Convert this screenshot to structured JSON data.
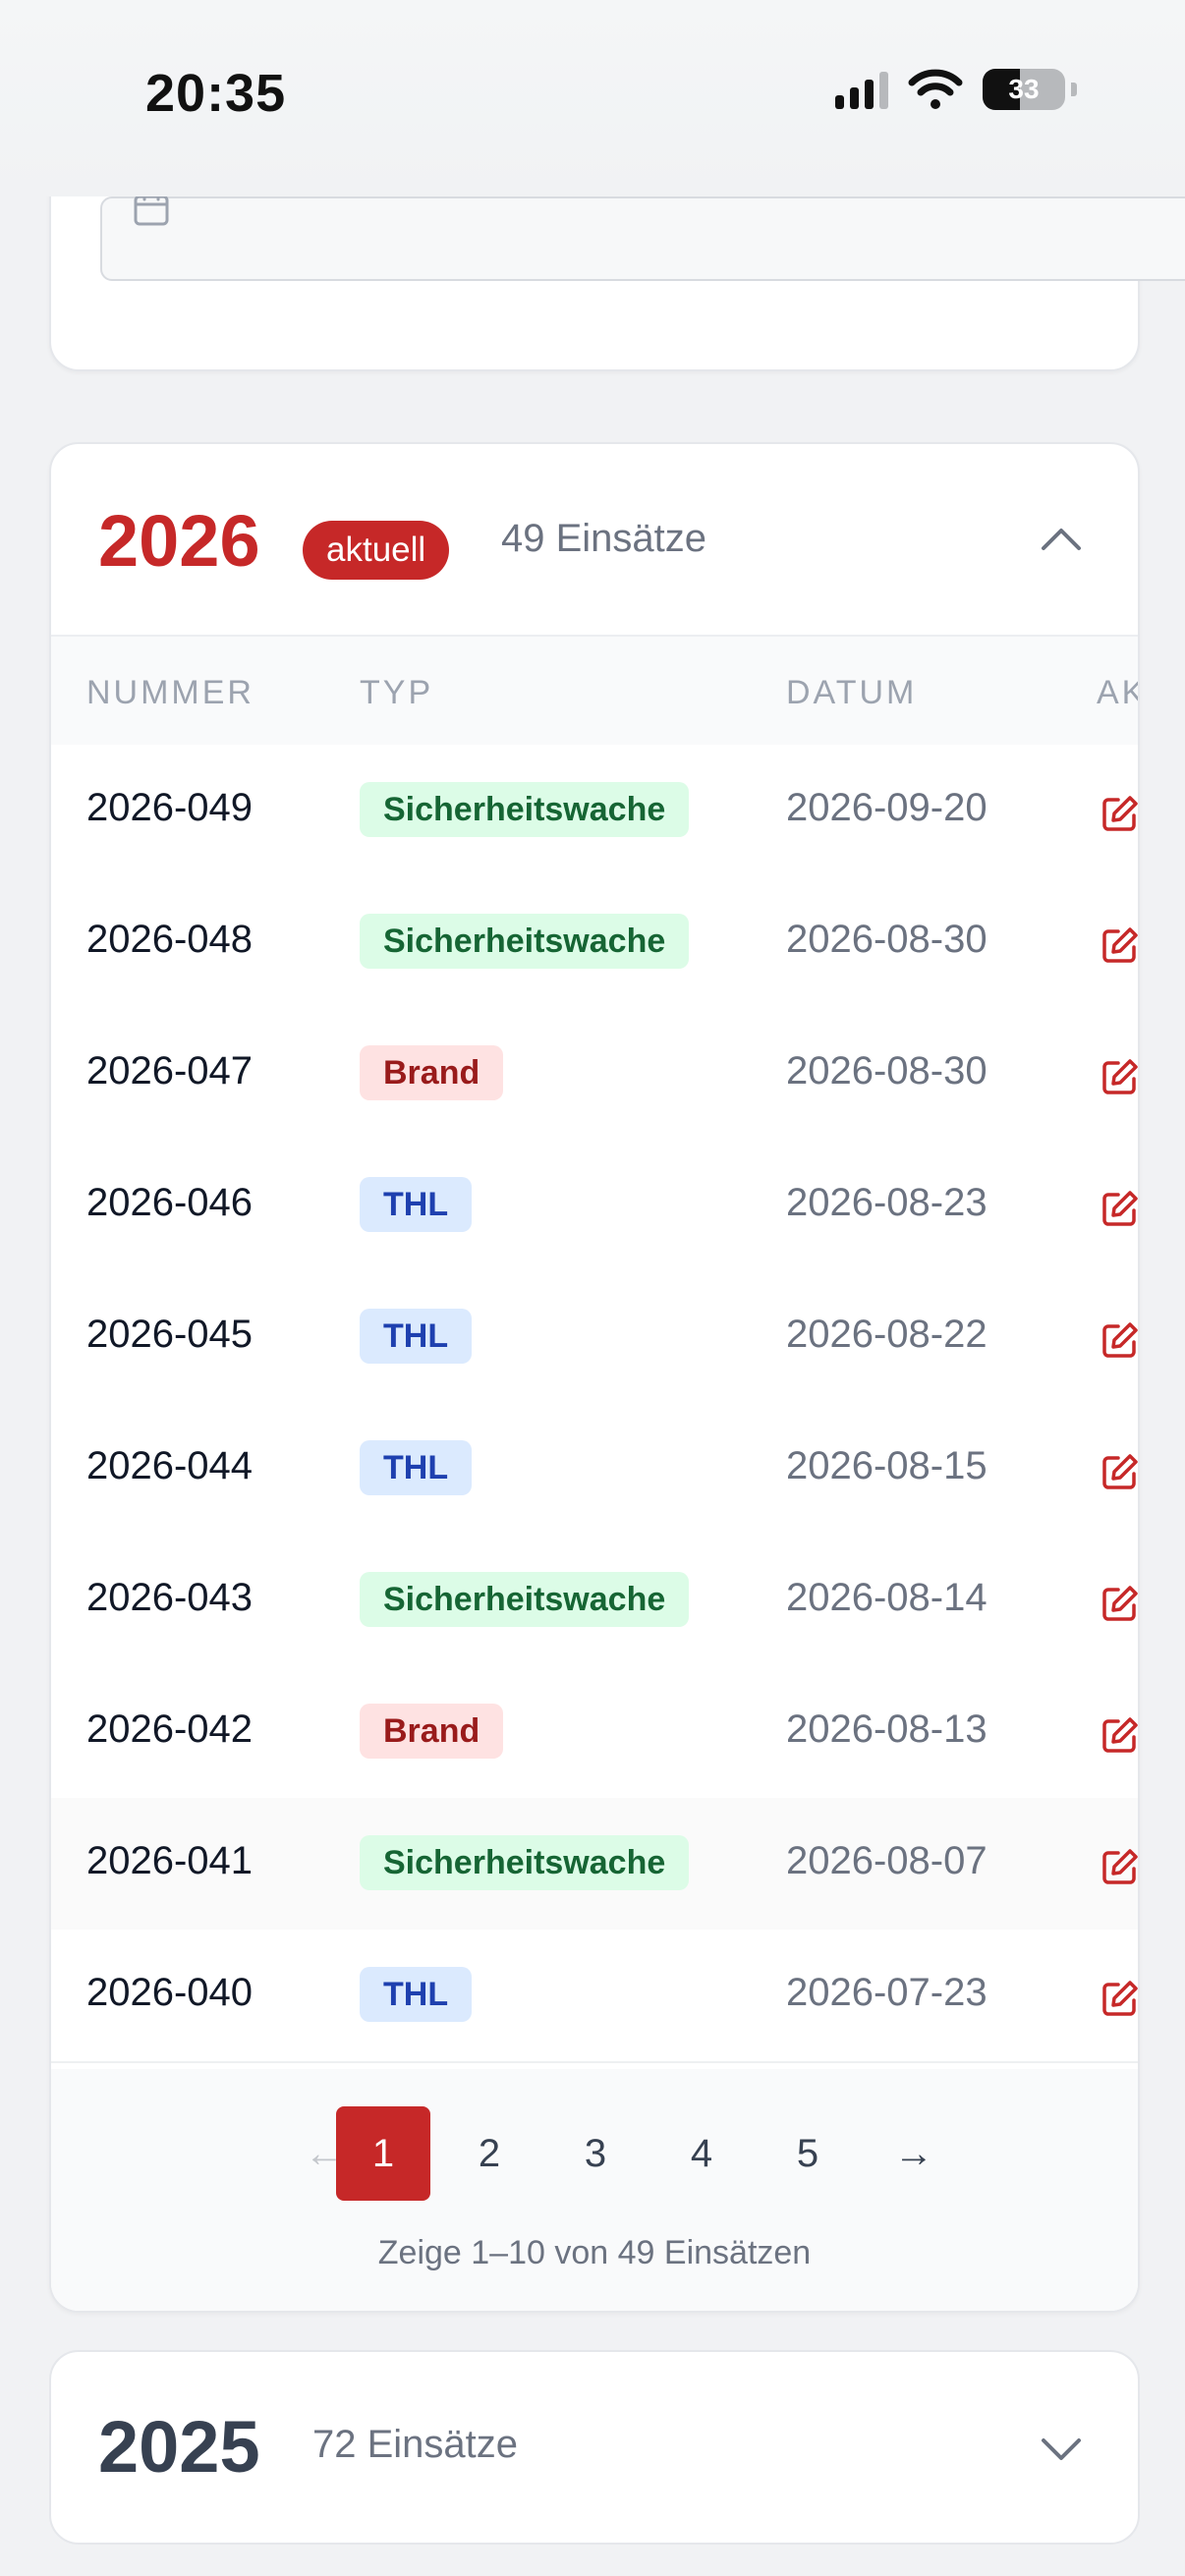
{
  "status_bar": {
    "time": "20:35",
    "battery": "33"
  },
  "year_2026": {
    "year": "2026",
    "badge": "aktuell",
    "count": "49 Einsätze",
    "columns": [
      "NUMMER",
      "TYP",
      "DATUM",
      "AKTIONEN"
    ],
    "rows": [
      {
        "number": "2026-049",
        "type": "Sicherheitswache",
        "date": "2026-09-20"
      },
      {
        "number": "2026-048",
        "type": "Sicherheitswache",
        "date": "2026-08-30"
      },
      {
        "number": "2026-047",
        "type": "Brand",
        "date": "2026-08-30"
      },
      {
        "number": "2026-046",
        "type": "THL",
        "date": "2026-08-23"
      },
      {
        "number": "2026-045",
        "type": "THL",
        "date": "2026-08-22"
      },
      {
        "number": "2026-044",
        "type": "THL",
        "date": "2026-08-15"
      },
      {
        "number": "2026-043",
        "type": "Sicherheitswache",
        "date": "2026-08-14"
      },
      {
        "number": "2026-042",
        "type": "Brand",
        "date": "2026-08-13"
      },
      {
        "number": "2026-041",
        "type": "Sicherheitswache",
        "date": "2026-08-07"
      },
      {
        "number": "2026-040",
        "type": "THL",
        "date": "2026-07-23"
      }
    ],
    "pagination": {
      "prev": "←",
      "next": "→",
      "pages": [
        "1",
        "2",
        "3",
        "4",
        "5"
      ],
      "current": "1",
      "info": "Zeige 1–10 von 49 Einsätzen"
    }
  },
  "year_2025": {
    "year": "2025",
    "count": "72 Einsätze"
  },
  "colors": {
    "accent": "#c62828",
    "green_badge_bg": "#dcfce7",
    "green_badge_fg": "#166534",
    "red_badge_bg": "#fee2e2",
    "red_badge_fg": "#991b1b",
    "blue_badge_bg": "#dbeafe",
    "blue_badge_fg": "#1e40af"
  },
  "icons": {
    "date_input": "calendar-icon",
    "collapse": "chevron-up-icon",
    "expand": "chevron-down-icon",
    "row_action": "edit-icon"
  }
}
